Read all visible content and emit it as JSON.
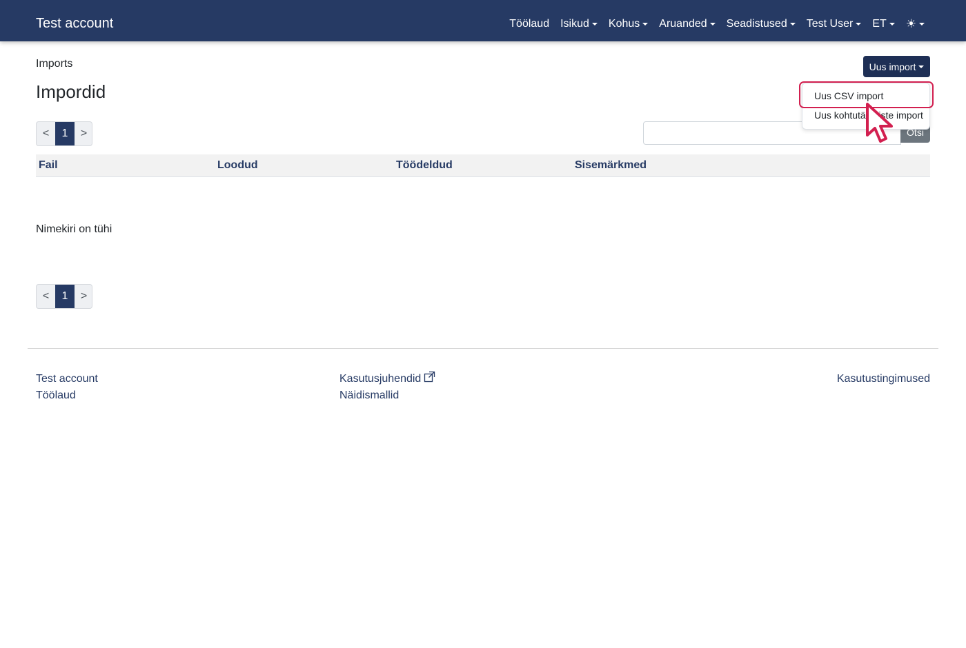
{
  "navbar": {
    "brand": "Test account",
    "items": [
      {
        "label": "Töölaud",
        "dropdown": false
      },
      {
        "label": "Isikud",
        "dropdown": true
      },
      {
        "label": "Kohus",
        "dropdown": true
      },
      {
        "label": "Aruanded",
        "dropdown": true
      },
      {
        "label": "Seadistused",
        "dropdown": true
      },
      {
        "label": "Test User",
        "dropdown": true
      },
      {
        "label": "ET",
        "dropdown": true
      }
    ],
    "theme_icon": "sun-icon",
    "background_color": "#263a64"
  },
  "page": {
    "breadcrumb": "Imports",
    "title": "Impordid"
  },
  "new_import": {
    "label": "Uus import",
    "menu_items": [
      "Uus CSV import",
      "Uus kohtutäitmiste import"
    ],
    "highlighted_index": 0
  },
  "search": {
    "placeholder": "",
    "button_label": "Otsi"
  },
  "pagination": {
    "prev": "<",
    "current": "1",
    "next": ">"
  },
  "table": {
    "columns": [
      "Fail",
      "Loodud",
      "Töödeldud",
      "Sisemärkmed"
    ],
    "empty_message": "Nimekiri on tühi"
  },
  "footer": {
    "col1": [
      "Test account",
      "Töölaud"
    ],
    "col2": [
      "Kasutusjuhendid",
      "Näidismallid"
    ],
    "col3": [
      "Kasutustingimused"
    ]
  }
}
